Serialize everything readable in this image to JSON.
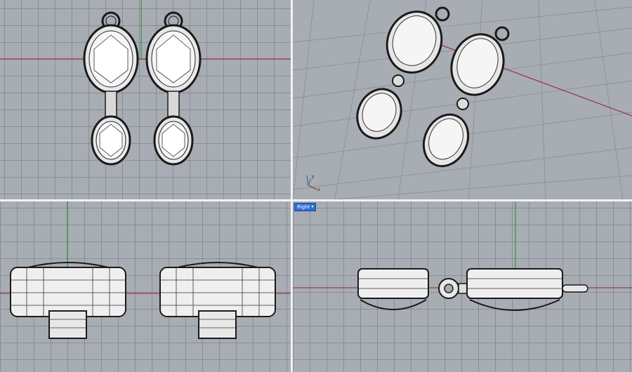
{
  "viewports": {
    "top": {
      "name": ""
    },
    "perspective": {
      "name": ""
    },
    "front": {
      "name": ""
    },
    "right": {
      "name": "Right",
      "caret": "▾",
      "active": true
    }
  },
  "colors": {
    "grid_bg": "#a8adb4",
    "x_axis": "#9a1e28",
    "y_axis": "#1e8a32",
    "model_fill": "#f4f4f4",
    "model_line": "#1a1a1a",
    "active_label": "#2f6fd0"
  },
  "axis_icon": {
    "x": "x",
    "y": "y"
  }
}
